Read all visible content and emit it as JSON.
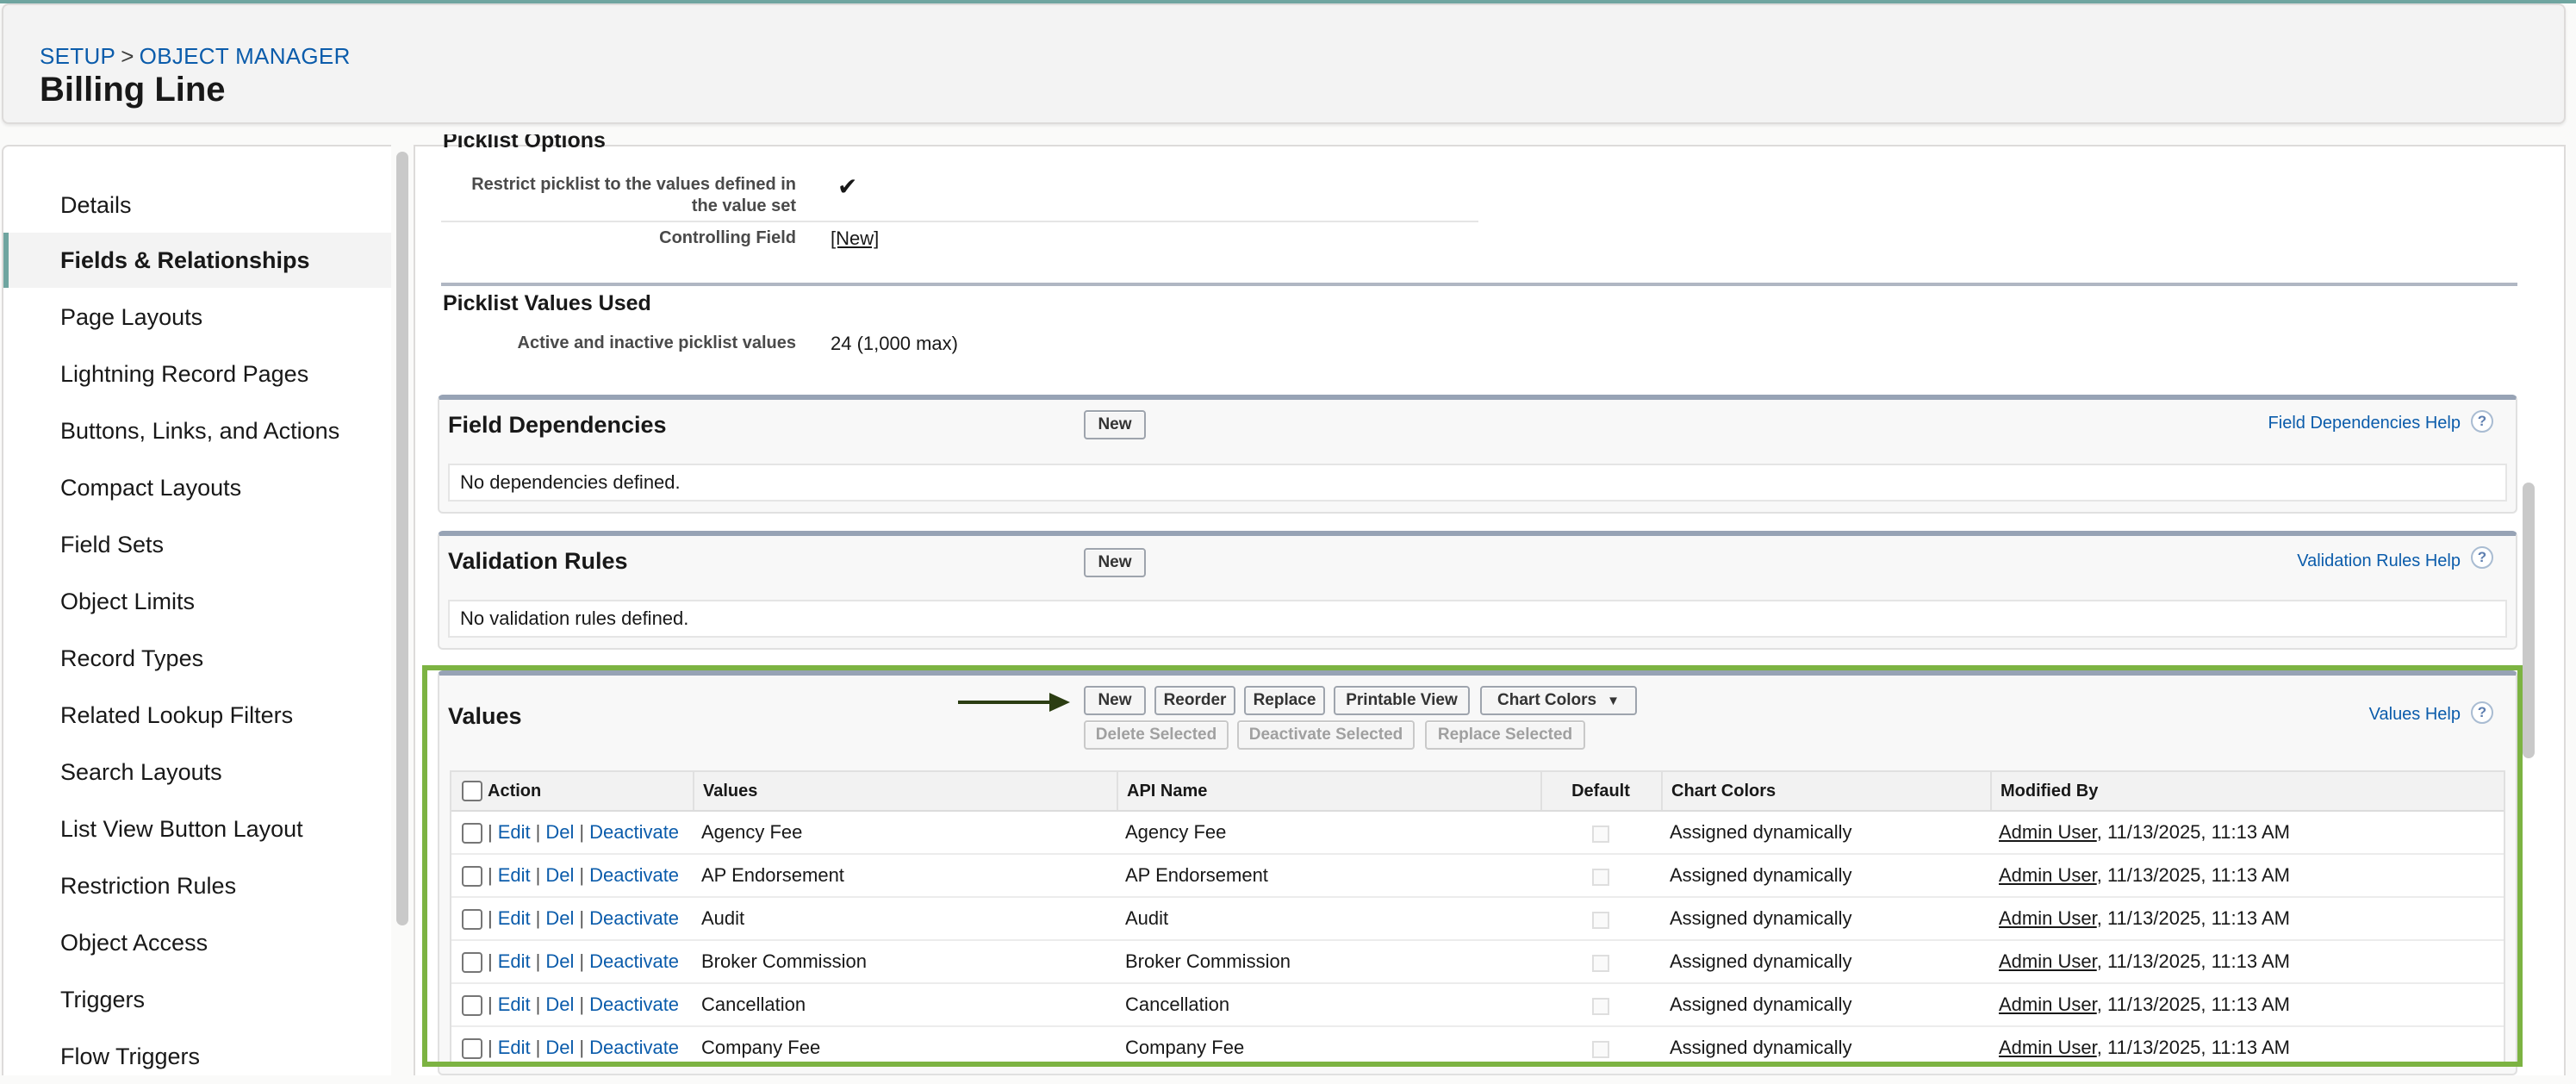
{
  "breadcrumb": {
    "setup": "SETUP",
    "separator": ">",
    "object_manager": "OBJECT MANAGER"
  },
  "page_title": "Billing Line",
  "sidebar": {
    "items": [
      {
        "label": "Details"
      },
      {
        "label": "Fields & Relationships",
        "active": true
      },
      {
        "label": "Page Layouts"
      },
      {
        "label": "Lightning Record Pages"
      },
      {
        "label": "Buttons, Links, and Actions"
      },
      {
        "label": "Compact Layouts"
      },
      {
        "label": "Field Sets"
      },
      {
        "label": "Object Limits"
      },
      {
        "label": "Record Types"
      },
      {
        "label": "Related Lookup Filters"
      },
      {
        "label": "Search Layouts"
      },
      {
        "label": "List View Button Layout"
      },
      {
        "label": "Restriction Rules"
      },
      {
        "label": "Object Access"
      },
      {
        "label": "Triggers"
      },
      {
        "label": "Flow Triggers"
      }
    ]
  },
  "picklist_options": {
    "title": "Picklist Options",
    "restrict_label": "Restrict picklist to the values defined in the value set",
    "restrict_label_line1": "Restrict picklist to the values defined in",
    "restrict_label_line2": "the value set",
    "restrict_checked": "✔",
    "controlling_field_label": "Controlling Field",
    "controlling_field_value": "[New]"
  },
  "picklist_values_used": {
    "title": "Picklist Values Used",
    "label": "Active and inactive picklist values",
    "value": "24 (1,000 max)"
  },
  "field_dependencies": {
    "title": "Field Dependencies",
    "new_button": "New",
    "help": "Field Dependencies Help",
    "empty": "No dependencies defined."
  },
  "validation_rules": {
    "title": "Validation Rules",
    "new_button": "New",
    "help": "Validation Rules Help",
    "empty": "No validation rules defined."
  },
  "values_section": {
    "title": "Values",
    "help": "Values Help",
    "buttons": {
      "new": "New",
      "reorder": "Reorder",
      "replace": "Replace",
      "printable_view": "Printable View",
      "chart_colors": "Chart Colors",
      "delete_selected": "Delete Selected",
      "deactivate_selected": "Deactivate Selected",
      "replace_selected": "Replace Selected"
    },
    "columns": {
      "action": "Action",
      "values": "Values",
      "api_name": "API Name",
      "default": "Default",
      "chart_colors": "Chart Colors",
      "modified_by": "Modified By"
    },
    "actions": {
      "edit": "Edit",
      "del": "Del",
      "deactivate": "Deactivate",
      "pipe": "|"
    },
    "rows": [
      {
        "value": "Agency Fee",
        "api_name": "Agency Fee",
        "chart_colors": "Assigned dynamically",
        "modified_user": "Admin User",
        "modified_date": ", 11/13/2025, 11:13 AM"
      },
      {
        "value": "AP Endorsement",
        "api_name": "AP Endorsement",
        "chart_colors": "Assigned dynamically",
        "modified_user": "Admin User",
        "modified_date": ", 11/13/2025, 11:13 AM"
      },
      {
        "value": "Audit",
        "api_name": "Audit",
        "chart_colors": "Assigned dynamically",
        "modified_user": "Admin User",
        "modified_date": ", 11/13/2025, 11:13 AM"
      },
      {
        "value": "Broker Commission",
        "api_name": "Broker Commission",
        "chart_colors": "Assigned dynamically",
        "modified_user": "Admin User",
        "modified_date": ", 11/13/2025, 11:13 AM"
      },
      {
        "value": "Cancellation",
        "api_name": "Cancellation",
        "chart_colors": "Assigned dynamically",
        "modified_user": "Admin User",
        "modified_date": ", 11/13/2025, 11:13 AM"
      },
      {
        "value": "Company Fee",
        "api_name": "Company Fee",
        "chart_colors": "Assigned dynamically",
        "modified_user": "Admin User",
        "modified_date": ", 11/13/2025, 11:13 AM"
      }
    ]
  },
  "colors": {
    "accent": "#6fa5a0",
    "link": "#0b5cab",
    "highlight": "#7cb342",
    "arrow": "#2b3d12"
  }
}
